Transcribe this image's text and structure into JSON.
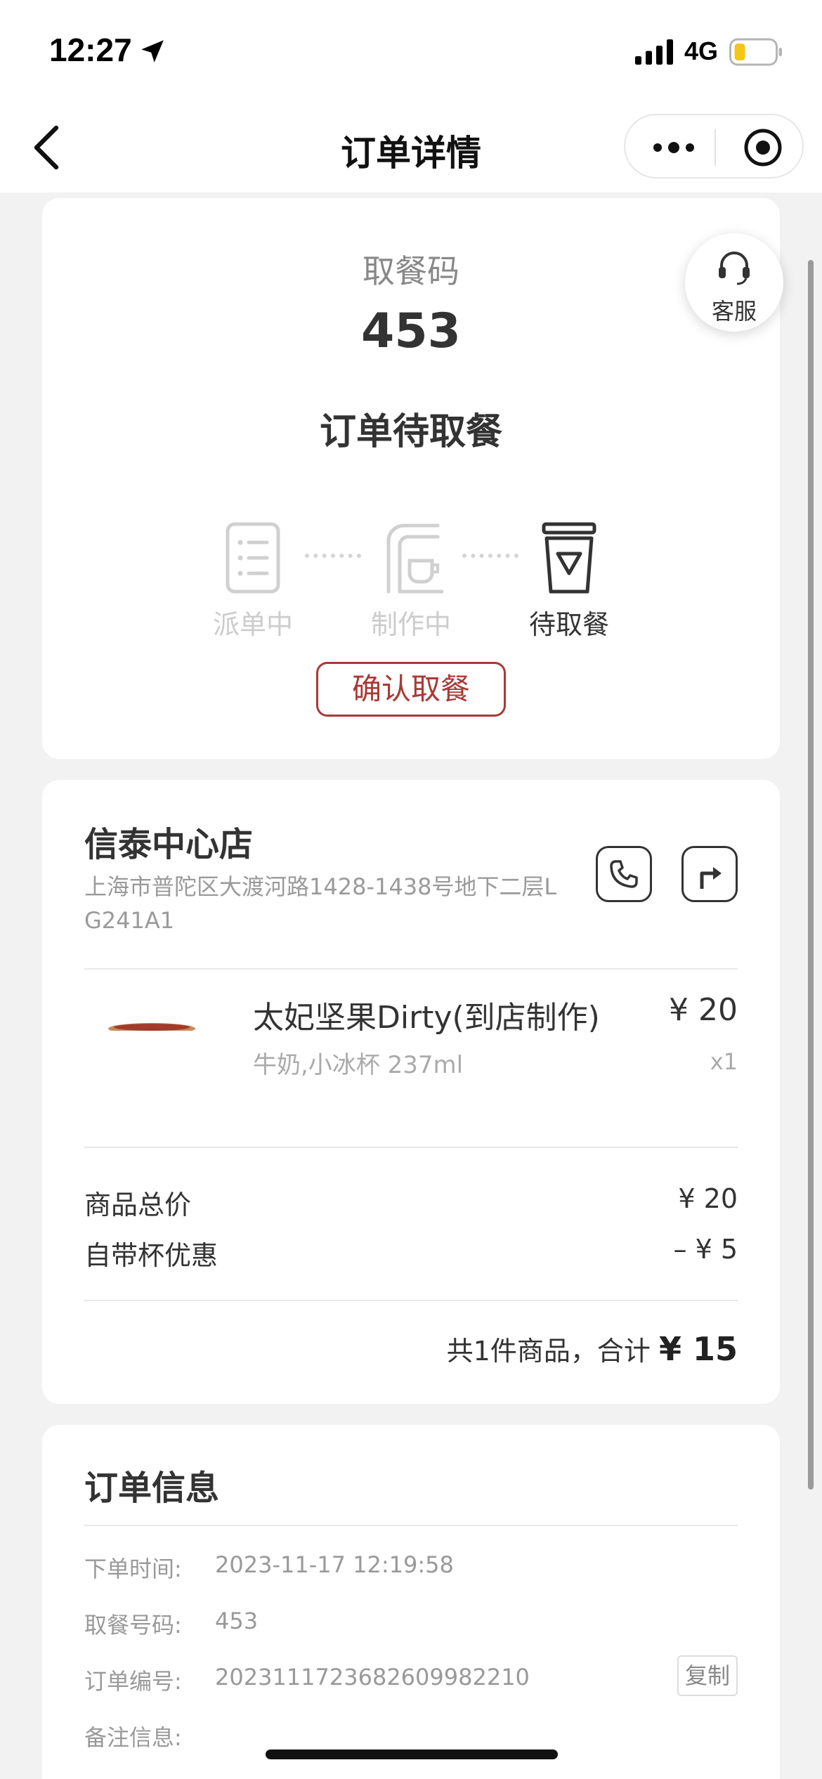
{
  "status_bar": {
    "time": "12:27",
    "network": "4G",
    "icons": [
      "location-arrow-icon",
      "signal-icon",
      "battery-icon"
    ],
    "battery_color": "#f5c518"
  },
  "nav": {
    "title": "订单详情",
    "icons": [
      "back-icon",
      "more-icon",
      "close-icon"
    ]
  },
  "pickup": {
    "label": "取餐码",
    "code": "453",
    "status": "订单待取餐",
    "service_label": "客服",
    "steps": [
      {
        "label": "派单中",
        "icon": "order-list-icon",
        "active": false
      },
      {
        "label": "制作中",
        "icon": "coffee-machine-icon",
        "active": false
      },
      {
        "label": "待取餐",
        "icon": "cup-icon",
        "active": true
      }
    ],
    "confirm_label": "确认取餐",
    "accent_color": "#a83a36"
  },
  "store": {
    "name": "信泰中心店",
    "address": "上海市普陀区大渡河路1428-1438号地下二层LG241A1",
    "icons": [
      "phone-icon",
      "navigate-icon"
    ],
    "product": {
      "name": "太妃坚果Dirty(到店制作)",
      "spec": "牛奶,小冰杯 237ml",
      "price": "¥ 20",
      "quantity": "x1"
    },
    "fees": {
      "subtotal_label": "商品总价",
      "subtotal_value": "¥ 20",
      "discount_label": "自带杯优惠",
      "discount_value": "–  ¥ 5"
    },
    "total_prefix": "共1件商品，合计",
    "total_amount": "¥ 15"
  },
  "order_info": {
    "title": "订单信息",
    "rows": [
      {
        "label": "下单时间:",
        "value": "2023-11-17 12:19:58"
      },
      {
        "label": "取餐号码:",
        "value": "453"
      },
      {
        "label": "订单编号:",
        "value": "20231117236826099822​10"
      },
      {
        "label": "备注信息:",
        "value": ""
      }
    ],
    "copy_label": "复制"
  }
}
